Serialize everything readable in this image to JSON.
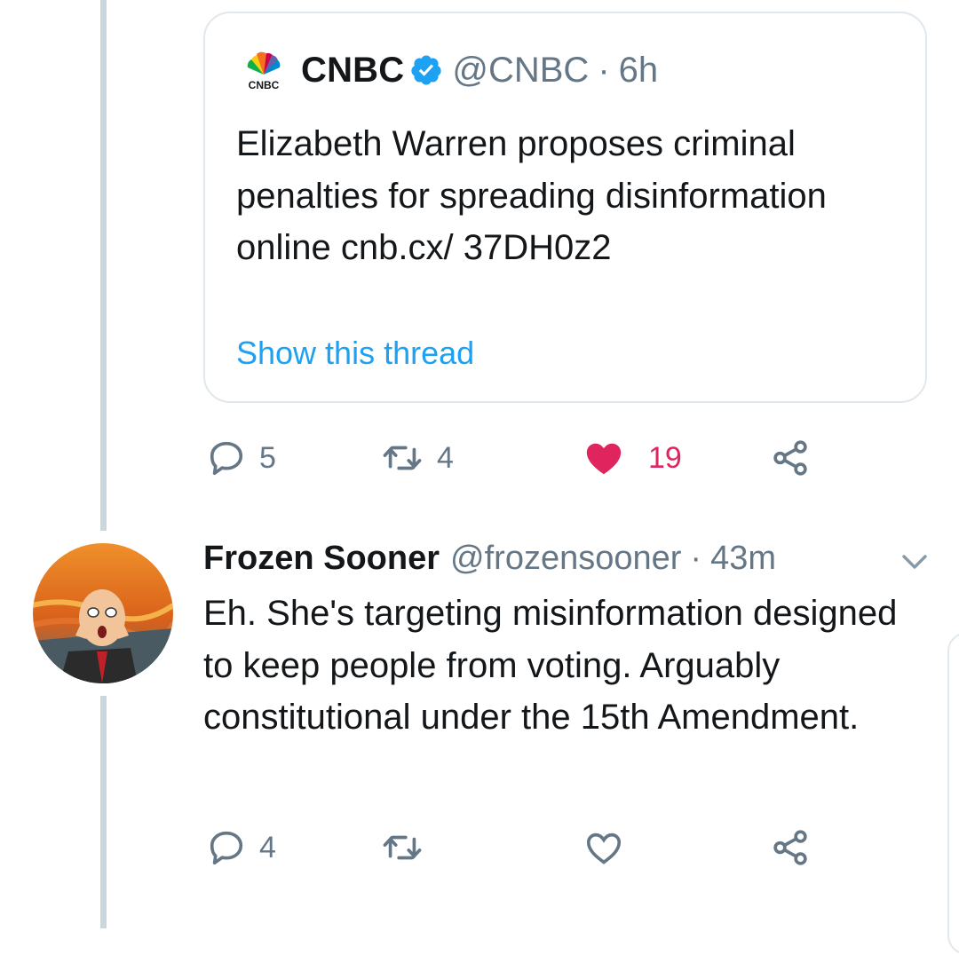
{
  "quoted_tweet": {
    "author_name": "CNBC",
    "handle": "@CNBC",
    "separator": "·",
    "time": "6h",
    "text": "Elizabeth Warren proposes criminal penalties for spreading disinformation online cnb.cx/ 37DH0z2",
    "show_thread": "Show this thread",
    "logo_icon": "cnbc-peacock-logo",
    "verified_icon": "verified-badge-icon"
  },
  "quoted_actions": {
    "reply_count": "5",
    "retweet_count": "4",
    "like_count": "19",
    "liked": true
  },
  "reply_tweet": {
    "author_name": "Frozen Sooner",
    "handle": "@frozensooner",
    "separator": "·",
    "time": "43m",
    "text": "Eh. She's targeting misinformation designed to keep people from voting. Arguably constitutional under the 15th Amendment."
  },
  "reply_actions": {
    "reply_count": "4",
    "retweet_count": "",
    "like_count": "",
    "liked": false
  },
  "colors": {
    "text_primary": "#14171a",
    "text_secondary": "#657786",
    "link": "#1da1f2",
    "like_active": "#e0245e",
    "thread_line": "#ccd6dd",
    "verified": "#1da1f2"
  }
}
